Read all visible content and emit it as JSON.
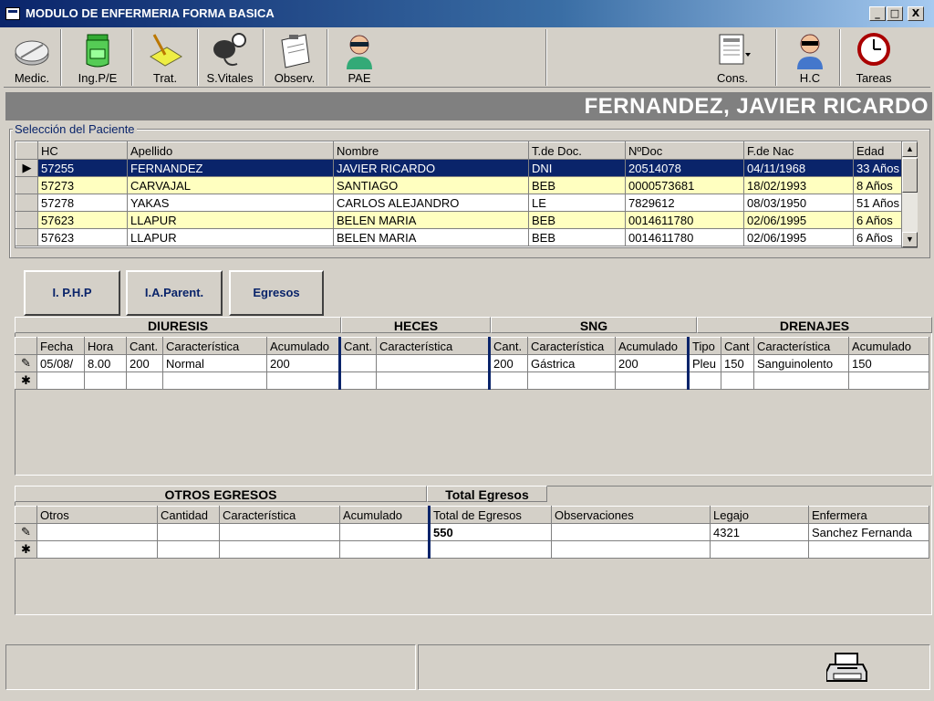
{
  "window": {
    "title": "MODULO DE ENFERMERIA FORMA BASICA",
    "min": "_",
    "max": "□",
    "close": "X"
  },
  "toolbar": [
    {
      "label": "Medic.",
      "icon": "pill-icon"
    },
    {
      "label": "Ing.P/E",
      "icon": "iv-jar-icon"
    },
    {
      "label": "Trat.",
      "icon": "notepad-pen-icon"
    },
    {
      "label": "S.Vitales",
      "icon": "blood-pressure-icon"
    },
    {
      "label": "Observ.",
      "icon": "clipboard-icon"
    },
    {
      "label": "PAE",
      "icon": "nurse-icon"
    },
    {
      "label": "Cons.",
      "icon": "report-icon"
    },
    {
      "label": "H.C",
      "icon": "doctor-icon"
    },
    {
      "label": "Tareas",
      "icon": "clock-icon"
    }
  ],
  "patient_name": "FERNANDEZ, JAVIER RICARDO",
  "patient_selection": {
    "label": "Selección del Paciente",
    "columns": [
      "HC",
      "Apellido",
      "Nombre",
      "T.de Doc.",
      "NºDoc",
      "F.de Nac",
      "Edad"
    ],
    "rows": [
      [
        "57255",
        "FERNANDEZ",
        "JAVIER RICARDO",
        "DNI",
        "20514078",
        "04/11/1968",
        "33 Años"
      ],
      [
        "57273",
        "CARVAJAL",
        "SANTIAGO",
        "BEB",
        "0000573681",
        "18/02/1993",
        "8 Años"
      ],
      [
        "57278",
        "YAKAS",
        "CARLOS ALEJANDRO",
        "LE",
        "7829612",
        "08/03/1950",
        "51 Años"
      ],
      [
        "57623",
        "LLAPUR",
        "BELEN MARIA",
        "BEB",
        "0014611780",
        "02/06/1995",
        "6 Años"
      ],
      [
        "57623",
        "LLAPUR",
        "BELEN MARIA",
        "BEB",
        "0014611780",
        "02/06/1995",
        "6 Años"
      ]
    ]
  },
  "tabs": [
    "I. P.H.P",
    "I.A.Parent.",
    "Egresos"
  ],
  "egresos": {
    "sections": [
      "DIURESIS",
      "HECES",
      "SNG",
      "DRENAJES"
    ],
    "columns": [
      "Fecha",
      "Hora",
      "Cant.",
      "Característica",
      "Acumulado",
      "Cant.",
      "Característica",
      "Cant.",
      "Característica",
      "Acumulado",
      "Tipo",
      "Cant",
      "Característica",
      "Acumulado"
    ],
    "row": [
      "05/08/",
      "8.00",
      "200",
      "Normal",
      "200",
      "",
      "",
      "200",
      "Gástrica",
      "200",
      "Pleu",
      "150",
      "Sanguinolento",
      "150"
    ],
    "edit_indicator": "✎",
    "new_indicator": "✱"
  },
  "otros": {
    "section": "OTROS EGRESOS",
    "total_section": "Total Egresos",
    "columns": [
      "Otros",
      "Cantidad",
      "Característica",
      "Acumulado",
      "Total de Egresos",
      "Observaciones",
      "Legajo",
      "Enfermera"
    ],
    "row": [
      "",
      "",
      "",
      "",
      "550",
      "",
      "4321",
      "Sanchez Fernanda"
    ]
  },
  "status": {
    "print_icon": "printer-icon"
  }
}
